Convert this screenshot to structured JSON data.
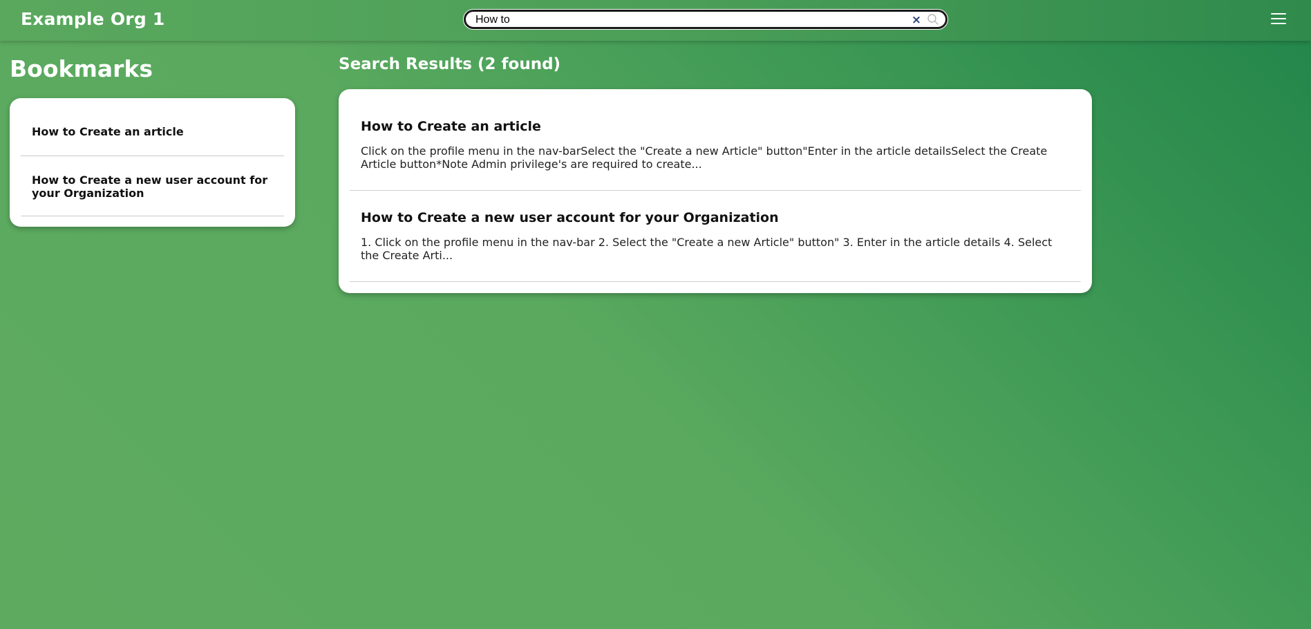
{
  "header": {
    "org_title": "Example Org 1",
    "search": {
      "value": "How to",
      "clear_glyph": "×",
      "clear_icon": "close-icon",
      "search_icon": "search-icon"
    },
    "menu_icon": "hamburger-menu-icon"
  },
  "bookmarks": {
    "title": "Bookmarks",
    "items": [
      {
        "label": "How to Create an article"
      },
      {
        "label": "How to Create a new user account for your Organization"
      }
    ]
  },
  "results": {
    "title": "Search Results (2 found)",
    "items": [
      {
        "title": "How to Create an article",
        "snippet": "Click on the profile menu in the nav-barSelect the \"Create a new Article\" button\"Enter in the article detailsSelect the Create Article button*Note Admin privilege's are required to create..."
      },
      {
        "title": "How to Create a new user account for your Organization",
        "snippet": "1. Click on the profile menu in the nav-bar 2. Select the \"Create a new Article\" button\" 3. Enter in the article details 4. Select the Create Arti..."
      }
    ]
  },
  "colors": {
    "background_gradient_start": "#5eab60",
    "background_gradient_end": "#22854a",
    "clear_icon": "#27457e",
    "card": "#ffffff"
  }
}
